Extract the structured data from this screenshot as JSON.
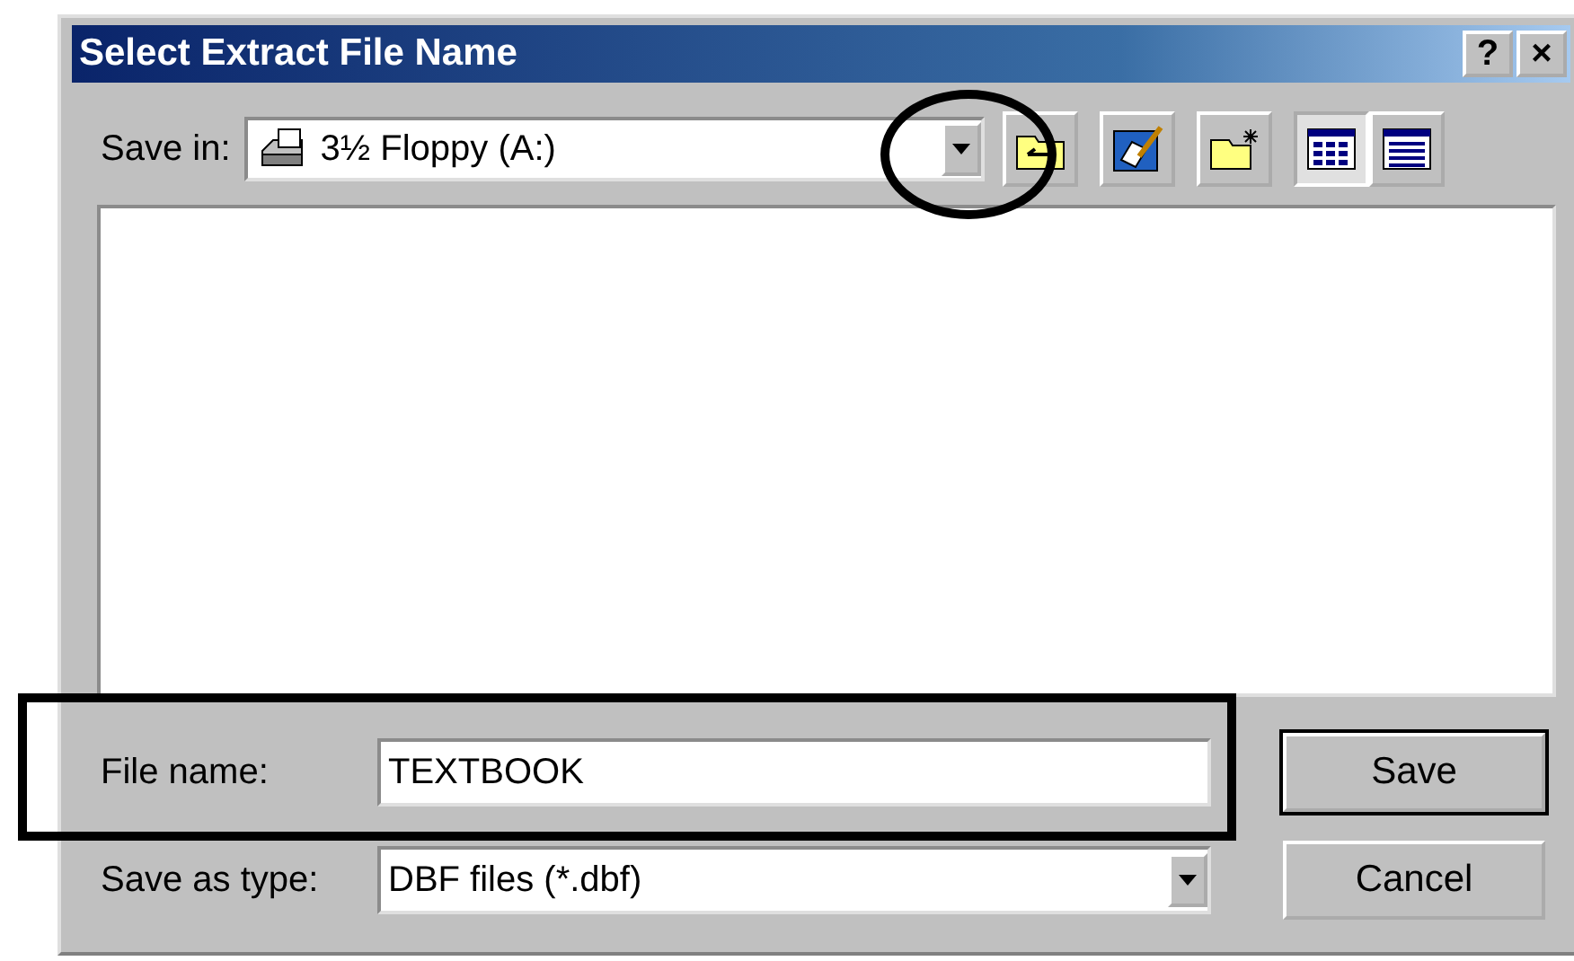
{
  "window": {
    "title": "Select Extract File Name",
    "title_buttons": [
      "?",
      "×"
    ]
  },
  "save_in": {
    "label": "Save in:",
    "value": "3½ Floppy (A:)"
  },
  "file_name": {
    "label": "File name:",
    "value": "TEXTBOOK"
  },
  "save_as_type": {
    "label": "Save as type:",
    "value": "DBF files (*.dbf)"
  },
  "buttons": [
    "Save",
    "Cancel"
  ],
  "view_buttons": [
    {
      "kind": "list",
      "selected": true
    },
    {
      "kind": "details",
      "selected": false
    }
  ]
}
